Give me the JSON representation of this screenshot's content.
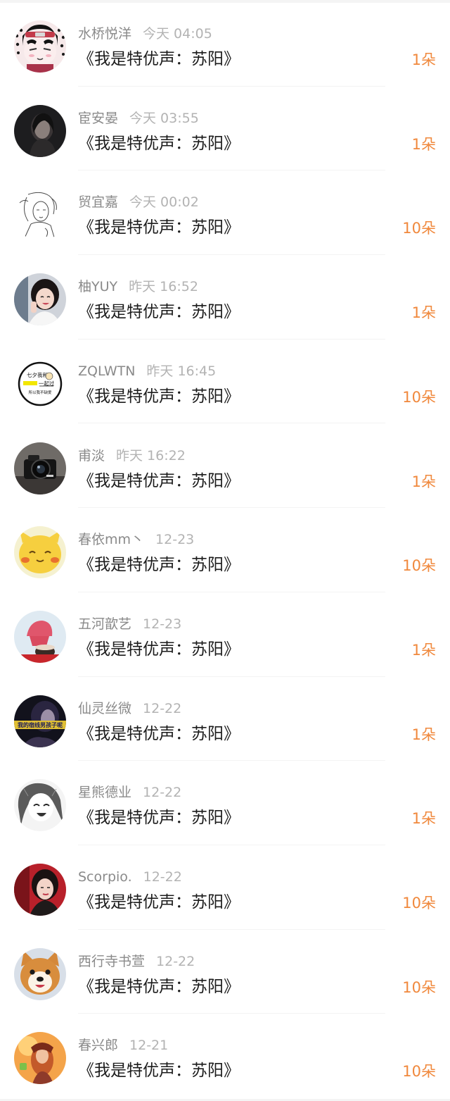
{
  "records": [
    {
      "username": "水桥悦洋",
      "time": "今天 04:05",
      "title": "《我是特优声：苏阳》",
      "amount": "1朵",
      "avatar": "anime-ninja-avatar-icon"
    },
    {
      "username": "宦安晏",
      "time": "今天 03:55",
      "title": "《我是特优声：苏阳》",
      "amount": "1朵",
      "avatar": "dark-portrait-avatar-icon"
    },
    {
      "username": "贸宜嘉",
      "time": "今天 00:02",
      "title": "《我是特优声：苏阳》",
      "amount": "10朵",
      "avatar": "sketch-girl-avatar-icon"
    },
    {
      "username": "柚YUY",
      "time": "昨天 16:52",
      "title": "《我是特优声：苏阳》",
      "amount": "1朵",
      "avatar": "smiling-girl-avatar-icon"
    },
    {
      "username": "ZQLWTN",
      "time": "昨天 16:45",
      "title": "《我是特优声：苏阳》",
      "amount": "10朵",
      "avatar": "text-badge-avatar-icon",
      "avatar_text": [
        "七夕我和",
        "一起过",
        "所以我不缺爱"
      ]
    },
    {
      "username": "甫淡",
      "time": "昨天 16:22",
      "title": "《我是特优声：苏阳》",
      "amount": "1朵",
      "avatar": "camera-avatar-icon"
    },
    {
      "username": "春依mm丶",
      "time": "12-23",
      "title": "《我是特优声：苏阳》",
      "amount": "10朵",
      "avatar": "yellow-cat-avatar-icon"
    },
    {
      "username": "五河歆艺",
      "time": "12-23",
      "title": "《我是特优声：苏阳》",
      "amount": "1朵",
      "avatar": "ice-cream-avatar-icon"
    },
    {
      "username": "仙灵丝微",
      "time": "12-22",
      "title": "《我是特优声：苏阳》",
      "amount": "1朵",
      "avatar": "text-banner-avatar-icon",
      "avatar_text": [
        "我的宿线男孩子呢"
      ]
    },
    {
      "username": "星熊德业",
      "time": "12-22",
      "title": "《我是特优声：苏阳》",
      "amount": "1朵",
      "avatar": "manga-girl-avatar-icon"
    },
    {
      "username": "Scorpio.",
      "time": "12-22",
      "title": "《我是特优声：苏阳》",
      "amount": "10朵",
      "avatar": "red-portrait-avatar-icon"
    },
    {
      "username": "西行寺书萱",
      "time": "12-22",
      "title": "《我是特优声：苏阳》",
      "amount": "10朵",
      "avatar": "shiba-dog-avatar-icon"
    },
    {
      "username": "春兴郎",
      "time": "12-21",
      "title": "《我是特优声：苏阳》",
      "amount": "10朵",
      "avatar": "game-character-avatar-icon"
    }
  ],
  "colors": {
    "username": "#8a8a8a",
    "time": "#b3b3b3",
    "title": "#1c1c1c",
    "amount": "#f0883c"
  }
}
